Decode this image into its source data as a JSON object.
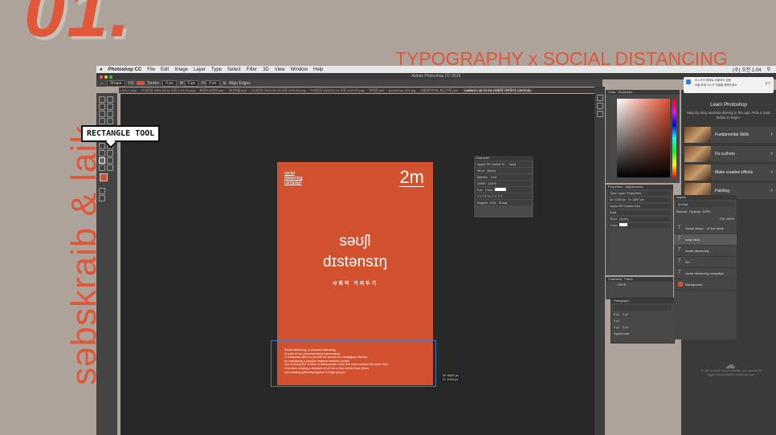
{
  "slide": {
    "number": "01.",
    "headline": "TYPOGRAPHY x SOCIAL DISTANCING",
    "vertical_text": "səbskraib & laik"
  },
  "menubar": {
    "app": "Photoshop CC",
    "items": [
      "File",
      "Edit",
      "Image",
      "Layer",
      "Type",
      "Select",
      "Filter",
      "3D",
      "View",
      "Window",
      "Help"
    ],
    "clock": "(수) 오전 1:04"
  },
  "window_title": "Adobe Photoshop CC 2019",
  "options_bar": {
    "shape": "Shape",
    "fill_label": "Fill:",
    "stroke_label": "Stroke:",
    "stroke_size": "0 px",
    "w_label": "W:",
    "w_value": "0 px",
    "h_label": "H:",
    "h_value": "0 px",
    "align_edges": "Align Edges"
  },
  "tabs": [
    "1 (31).1.png",
    "스크린샷 2020-04-12 오전 1.21.21.png",
    "화면스크린샷.psd",
    "이미지들.psd",
    "스크린샷 2020-04-14 오후 4.09.29.png",
    "스크린샷 2020-04-14 오후 4.03.03.png",
    "아이콘.psd",
    "gomorrow_001.jpg",
    "사용한이미지_최근기록.psd",
    "Untitled-1 @ 33.3% (사회적 거리두기, CMYK/8)"
  ],
  "tooltip": "RECTANGLE TOOL",
  "document": {
    "small_title": [
      "social",
      "distancing",
      "campaign"
    ],
    "distance": "2m",
    "ipa_line1": "səʊʃl",
    "ipa_line2": "dɪstənsɪŋ",
    "korean": "사회적 거리두기",
    "paragraph": [
      "Social distancing, or physical distancing,",
      "is a set of non-pharmaceutical interventions",
      "or measures taken to prevent the spread of a contagious disease",
      "by maintaining a physical distance between people",
      "and reducing the number of times people come into close contact with each other.",
      "It involves keeping a distance of six feet or two meters from others",
      "and avoiding gathering together in large groups."
    ],
    "selection_w": "W: 0682 px",
    "selection_h": "H: 1033 px"
  },
  "character_panel": {
    "title": "Character",
    "font": "Apple SD Gothic N...",
    "style": "Bold",
    "size": "36 pt",
    "leading": "(Auto)",
    "kerning": "Metrics",
    "tracking": "-100",
    "vscale": "100%",
    "hscale": "100%",
    "baseline": "0 pt",
    "color_label": "Color:",
    "language": "English: USA",
    "aa": "Sharp"
  },
  "color_panel": {
    "tabs": [
      "Color",
      "Swatches"
    ]
  },
  "properties_panel": {
    "tabs": [
      "Properties",
      "Adjustments"
    ],
    "type_label": "Type Layer Properties",
    "w": "W: 1159 px",
    "h": "H: 3897 px",
    "font": "Apple SD Gothic Neo",
    "style": "Bold",
    "size": "36 pt",
    "tracking": "(Auto)",
    "color_label": "Color:"
  },
  "channels_panel": {
    "tabs": [
      "Channels",
      "Paths"
    ],
    "row": "CMYK"
  },
  "paragraph_panel": {
    "title": "Paragraph",
    "indent_left": "0 pt",
    "indent_right": "0 pt",
    "first_line": "0 pt",
    "space_before": "0 pt",
    "space_after": "0 pt",
    "hyphenate": "Hyphenate"
  },
  "layers_panel": {
    "title": "Layers",
    "kind": "Q Kind",
    "blend": "Normal",
    "opacity_label": "Opacity:",
    "opacity": "100%",
    "fill_label": "Fill:",
    "fill": "100%",
    "layers": [
      "Social distan... of two mete",
      "səʊʃl dɪstə",
      "social distancing",
      "2m",
      "social distancing campaign",
      "Background"
    ]
  },
  "learn_panel": {
    "title": "Learn Photoshop",
    "description": "Step-by-step tutorials directly in the app. Pick a topic below to begin.",
    "cards": [
      "Fundamental Skills",
      "Fix a photo",
      "Make creative effects",
      "Painting"
    ]
  },
  "notification": {
    "line1": "디스크가 제대로 추출되지 않음",
    "line2": "추출 후에 디스크 연결을 해제하세요",
    "button": "닫기"
  },
  "cloud_message": "To use Creative Cloud Libraries, you need to be logged into a Creative Cloud account."
}
